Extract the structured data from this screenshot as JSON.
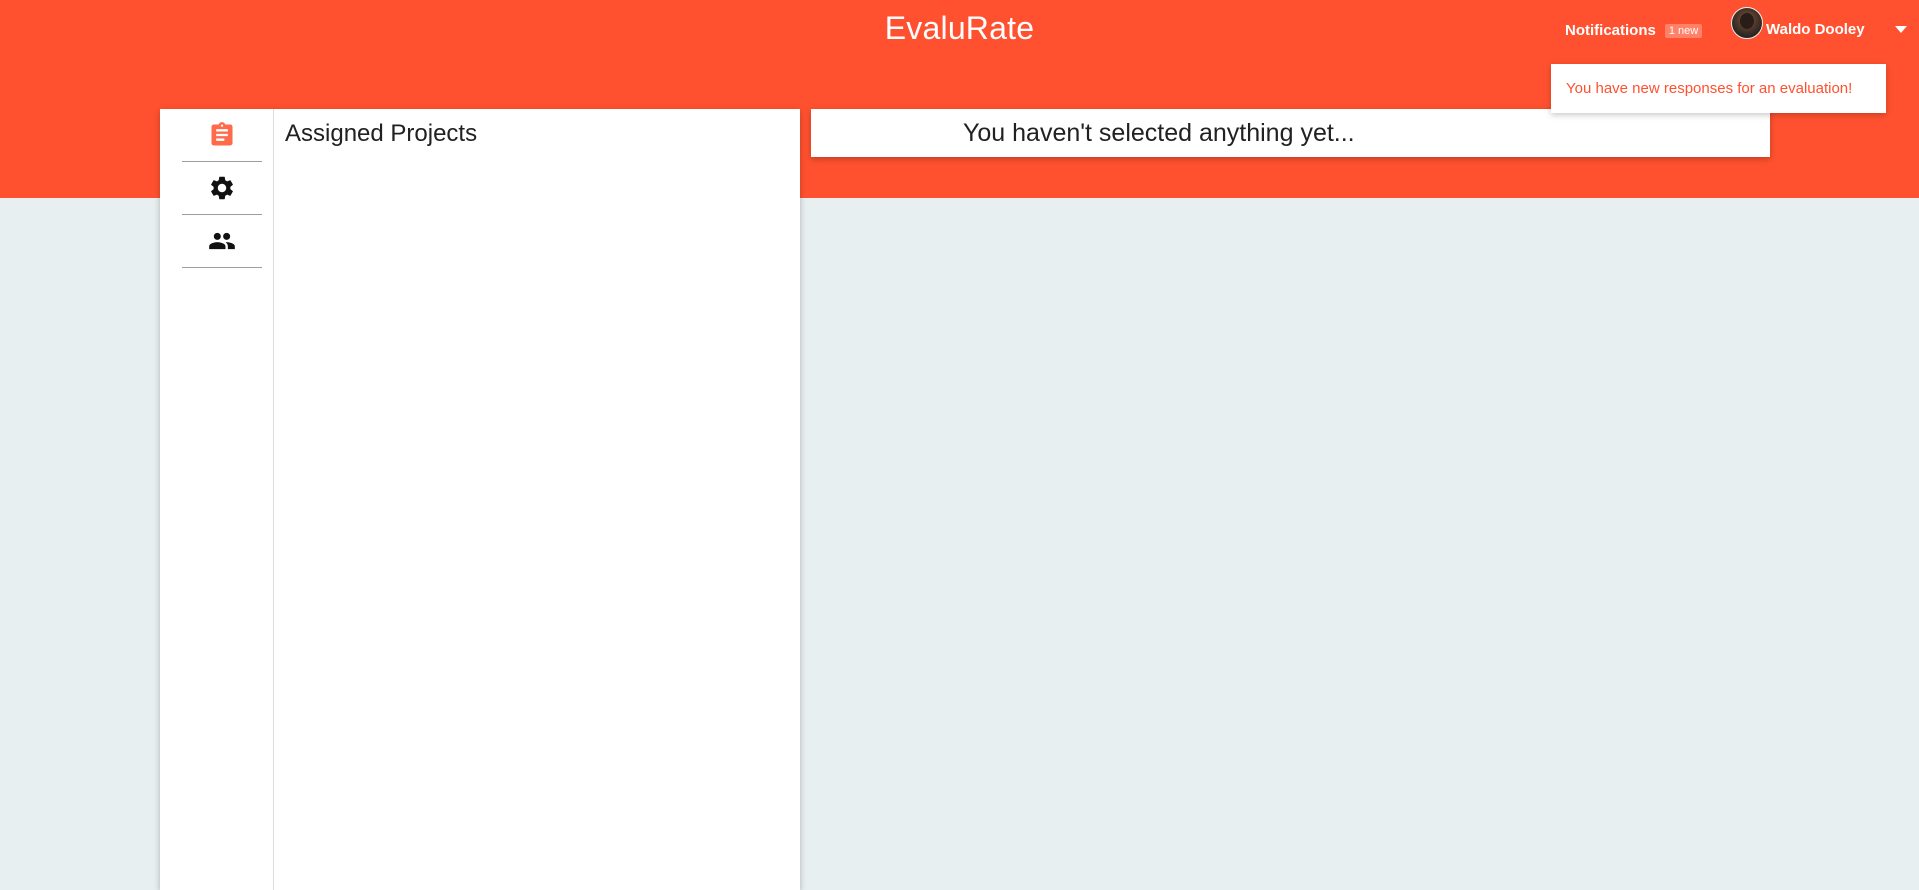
{
  "header": {
    "app_title": "EvaluRate",
    "notifications_label": "Notifications",
    "notifications_badge": "1 new",
    "user_name": "Waldo Dooley"
  },
  "toast": {
    "message": "You have new responses for an evaluation!"
  },
  "sidebar": {
    "items": [
      {
        "name": "projects",
        "icon": "clipboard-icon",
        "active": true
      },
      {
        "name": "settings",
        "icon": "gear-icon",
        "active": false
      },
      {
        "name": "people",
        "icon": "people-icon",
        "active": false
      }
    ]
  },
  "left_panel": {
    "title": "Assigned Projects"
  },
  "detail": {
    "empty_message": "You haven't selected anything yet..."
  },
  "colors": {
    "accent": "#ff512f",
    "background": "#e8eff0",
    "icon_active": "#ff6a4a",
    "icon_default": "#111111"
  }
}
